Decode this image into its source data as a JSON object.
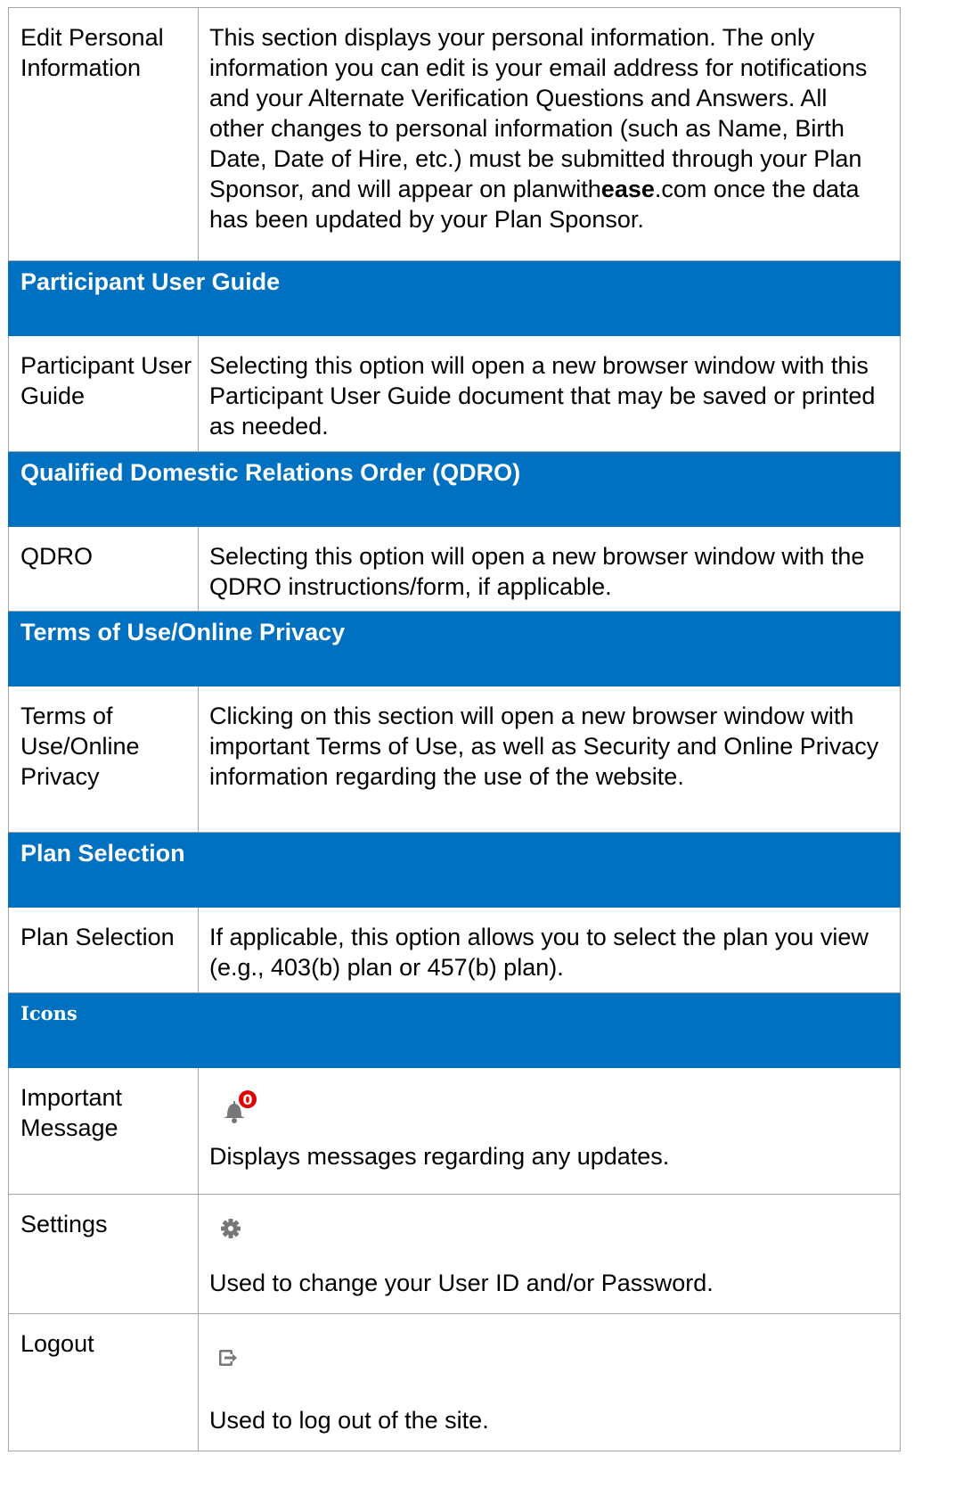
{
  "rows": {
    "edit_personal_info": {
      "label": "Edit Personal Information",
      "desc_part1": "This section displays your personal information. The only information you can edit is your email address for notifications and your Alternate Verification Questions and Answers. All other changes to personal information (such as Name, Birth Date, Date of Hire, etc.) must be submitted through your Plan Sponsor, and will appear on planwith",
      "desc_brand": "ease",
      "desc_part2": ".com once the data has been updated by your Plan Sponsor."
    },
    "participant_user_guide": {
      "section_title": "Participant User Guide",
      "label": "Participant User Guide",
      "desc": "Selecting this option will open a new browser window with this Participant User Guide document that may be saved or printed as needed."
    },
    "qdro": {
      "section_title": "Qualified Domestic Relations Order (QDRO)",
      "label": "QDRO",
      "desc": "Selecting this option will open a new browser window with the QDRO instructions/form, if applicable."
    },
    "terms": {
      "section_title": "Terms of Use/Online Privacy",
      "label": "Terms of Use/Online Privacy",
      "desc": "Clicking on this section will open a new browser window with important Terms of Use, as well as Security and Online Privacy information regarding the use of the website."
    },
    "plan_selection": {
      "section_title": "Plan Selection",
      "label": "Plan Selection",
      "desc": "If applicable, this option allows you to select the plan you view (e.g., 403(b) plan or 457(b) plan)."
    },
    "icons": {
      "section_title": "Icons"
    },
    "important_message": {
      "label": "Important Message",
      "badge_count": "0",
      "icon": "bell-icon",
      "desc": "Displays messages regarding any updates."
    },
    "settings": {
      "label": "Settings",
      "icon": "gear-icon",
      "desc": "Used to change your User ID and/or Password."
    },
    "logout": {
      "label": "Logout",
      "icon": "logout-icon",
      "desc": "Used to log out of the site."
    }
  },
  "colors": {
    "section_header_bg": "#0070c0",
    "section_header_text": "#ffffff",
    "border": "#a6a6a6",
    "badge": "#e00000",
    "icon_gray": "#777777"
  }
}
